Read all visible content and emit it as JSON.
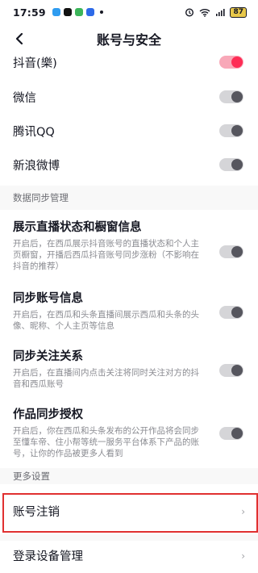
{
  "status_bar": {
    "time": "17:59",
    "battery": "87"
  },
  "header": {
    "title": "账号与安全"
  },
  "bindings": [
    {
      "label": "抖音(樂)",
      "on": true
    },
    {
      "label": "微信",
      "on": false
    },
    {
      "label": "腾讯QQ",
      "on": false
    },
    {
      "label": "新浪微博",
      "on": false
    }
  ],
  "data_sync": {
    "section_title": "数据同步管理",
    "items": [
      {
        "title": "展示直播状态和橱窗信息",
        "desc": "开启后，在西瓜展示抖音账号的直播状态和个人主页橱窗，开播后西瓜抖音账号同步涨粉（不影响在抖音的推荐）",
        "on": false
      },
      {
        "title": "同步账号信息",
        "desc": "开启后，在西瓜和头条直播间展示西瓜和头条的头像、昵称、个人主页等信息",
        "on": false
      },
      {
        "title": "同步关注关系",
        "desc": "开启后，在直播间内点击关注将同时关注对方的抖音和西瓜账号",
        "on": false
      },
      {
        "title": "作品同步授权",
        "desc": "开启后，你在西瓜和头条发布的公开作品将会同步至懂车帝、住小帮等统一服务平台体系下产品的账号，让你的作品被更多人看到",
        "on": false
      }
    ]
  },
  "more": {
    "section_title": "更多设置",
    "items": [
      {
        "label": "账号注销"
      },
      {
        "label": "登录设备管理"
      }
    ]
  },
  "colors": {
    "accent": "#fe2c55",
    "highlight": "#e03030"
  }
}
